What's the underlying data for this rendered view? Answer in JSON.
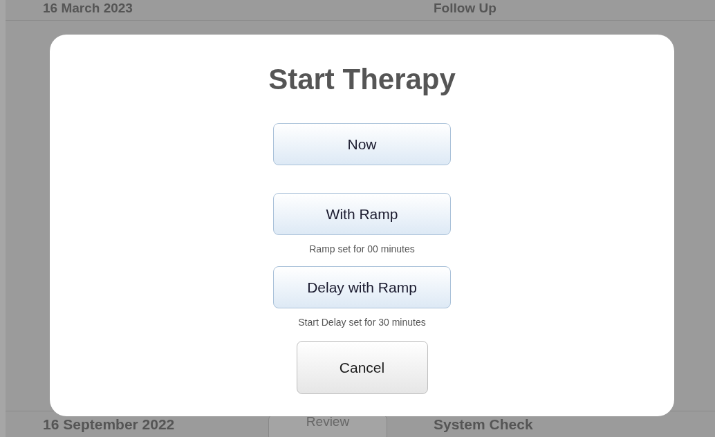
{
  "background": {
    "top_row": {
      "date": "16 March 2023",
      "label": "Follow Up"
    },
    "bottom_row": {
      "date": "16 September 2022",
      "button": "Review",
      "label": "System Check"
    }
  },
  "dialog": {
    "title": "Start Therapy",
    "options": [
      {
        "label": "Now"
      },
      {
        "label": "With Ramp",
        "note": "Ramp set for 00 minutes"
      },
      {
        "label": "Delay with Ramp",
        "note": "Start Delay set for 30 minutes"
      }
    ],
    "cancel": "Cancel"
  }
}
